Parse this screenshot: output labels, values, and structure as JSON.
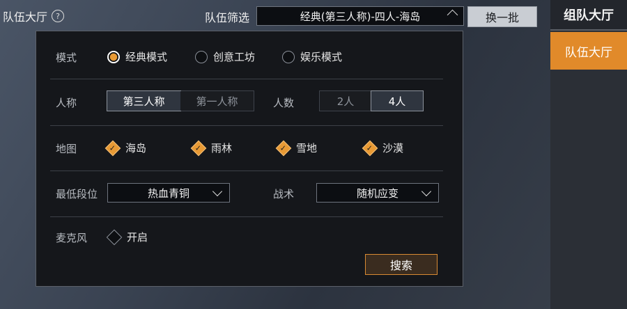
{
  "header": {
    "title": "队伍大厅",
    "help_icon": "?",
    "filter_label": "队伍筛选",
    "filter_value": "经典(第三人称)-四人-海岛",
    "refresh_label": "换一批"
  },
  "side": {
    "team_tab": "组队大厅",
    "hall_tab": "队伍大厅",
    "accent": "#e18a2a"
  },
  "dialog": {
    "mode": {
      "label": "模式",
      "options": [
        "经典模式",
        "创意工坊",
        "娱乐模式"
      ],
      "selected": "经典模式"
    },
    "perspective": {
      "label": "人称",
      "options": [
        "第三人称",
        "第一人称"
      ],
      "selected": "第三人称"
    },
    "squad": {
      "label": "人数",
      "options": [
        "2人",
        "4人"
      ],
      "selected": "4人"
    },
    "map": {
      "label": "地图",
      "options": [
        "海岛",
        "雨林",
        "雪地",
        "沙漠"
      ],
      "checked": [
        "海岛",
        "雨林",
        "雪地",
        "沙漠"
      ]
    },
    "rank": {
      "label": "最低段位",
      "value": "热血青铜"
    },
    "tactic": {
      "label": "战术",
      "value": "随机应变"
    },
    "mic": {
      "label": "麦克风",
      "option": "开启",
      "checked": false
    },
    "search_label": "搜索"
  }
}
